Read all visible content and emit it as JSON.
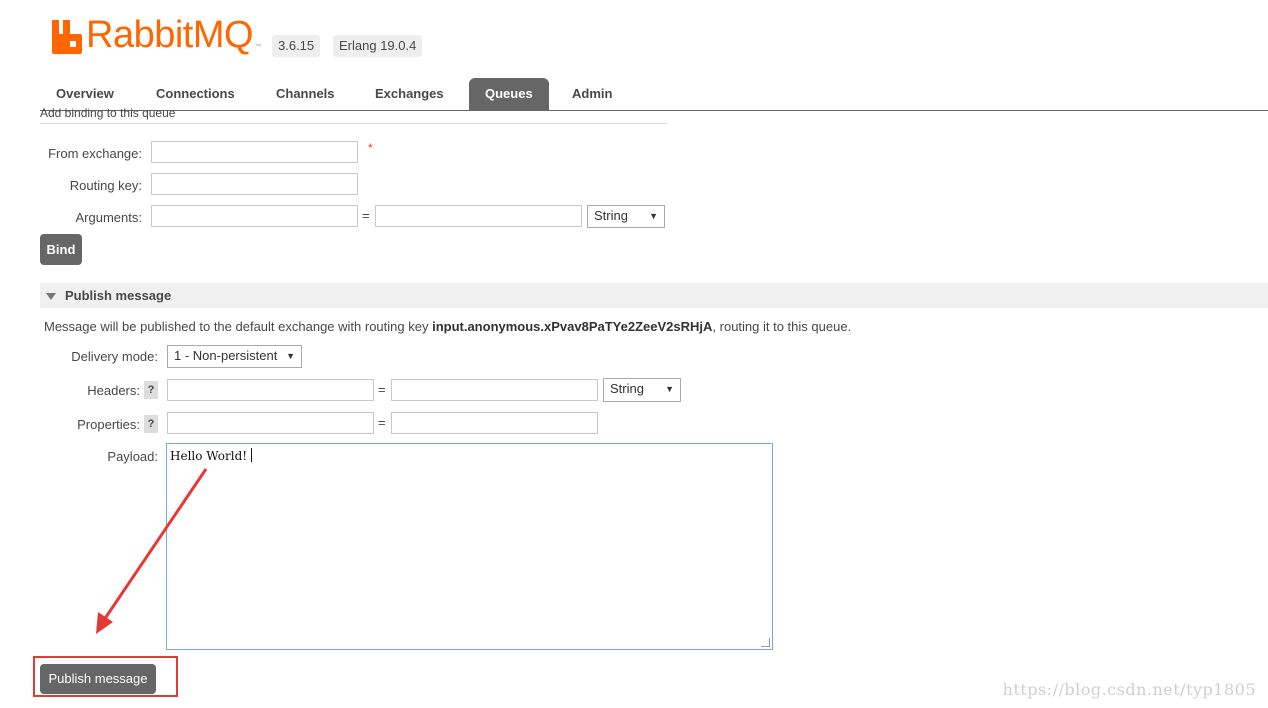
{
  "app": {
    "logo_text": "RabbitMQ",
    "logo_tm": "™",
    "version": "3.6.15",
    "erlang": "Erlang 19.0.4",
    "brand_color": "#ff6600"
  },
  "tabs": [
    {
      "label": "Overview"
    },
    {
      "label": "Connections"
    },
    {
      "label": "Channels"
    },
    {
      "label": "Exchanges"
    },
    {
      "label": "Queues",
      "active": true
    },
    {
      "label": "Admin"
    }
  ],
  "binding": {
    "section_title": "Add binding to this queue",
    "from_exchange_label": "From exchange:",
    "from_exchange_value": "",
    "required_marker": "*",
    "routing_key_label": "Routing key:",
    "routing_key_value": "",
    "arguments_label": "Arguments:",
    "arguments_key": "",
    "arguments_value": "",
    "equals": "=",
    "arguments_type": "String",
    "bind_button": "Bind"
  },
  "publish": {
    "section_title": "Publish message",
    "desc_prefix": "Message will be published to the default exchange with routing key ",
    "routing_key": "input.anonymous.xPvav8PaTYe2ZeeV2sRHjA",
    "desc_suffix": ", routing it to this queue.",
    "delivery_mode_label": "Delivery mode:",
    "delivery_mode_value": "1 - Non-persistent",
    "headers_label": "Headers:",
    "headers_type": "String",
    "properties_label": "Properties:",
    "help": "?",
    "equals": "=",
    "payload_label": "Payload:",
    "payload_value": "Hello World!",
    "publish_button": "Publish message"
  },
  "annotation": {
    "arrow_color": "#e53935",
    "watermark": "https://blog.csdn.net/typ1805"
  }
}
